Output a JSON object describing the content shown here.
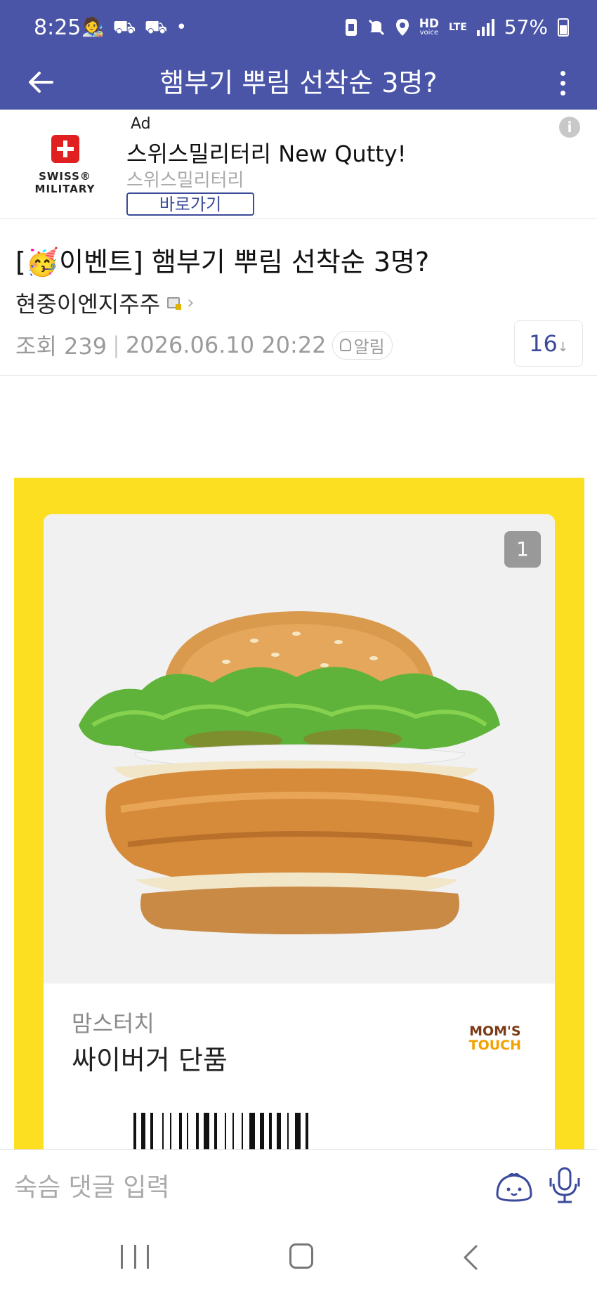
{
  "status_bar": {
    "time": "8:25",
    "notification_icons": "🧑‍🎨 ⛟ ⛟ •",
    "hd_label": "HD",
    "voice_label": "voice",
    "lte_label": "LTE",
    "battery": "57%"
  },
  "header": {
    "title": "햄부기 뿌림 선착순 3명?"
  },
  "ad": {
    "tag": "Ad",
    "brand_line1": "SWISS®",
    "brand_line2": "MILITARY",
    "title": "스위스밀리터리 New Qutty!",
    "advertiser": "스위스밀리터리",
    "cta": "바로가기",
    "info": "i"
  },
  "post": {
    "title": "[🥳이벤트] 햄부기 뿌림 선착순 3명?",
    "author": "현중이엔지주주",
    "views": "조회 239",
    "datetime": "2026.06.10 20:22",
    "alarm_label": "알림",
    "comment_count": "16",
    "comment_arrow": "↓"
  },
  "coupon": {
    "page_number": "1",
    "store": "맘스터치",
    "product": "싸이버거 단품",
    "logo_line1": "MOM'S",
    "logo_line2": "TOUCH",
    "colors": {
      "frame": "#fddf22",
      "logo_brown": "#7b3b16",
      "logo_orange": "#f2a200"
    }
  },
  "comment_bar": {
    "placeholder": "숙슴 댓글 입력"
  },
  "colors": {
    "header_bg": "#4a55a8",
    "accent": "#3b4a9a"
  }
}
